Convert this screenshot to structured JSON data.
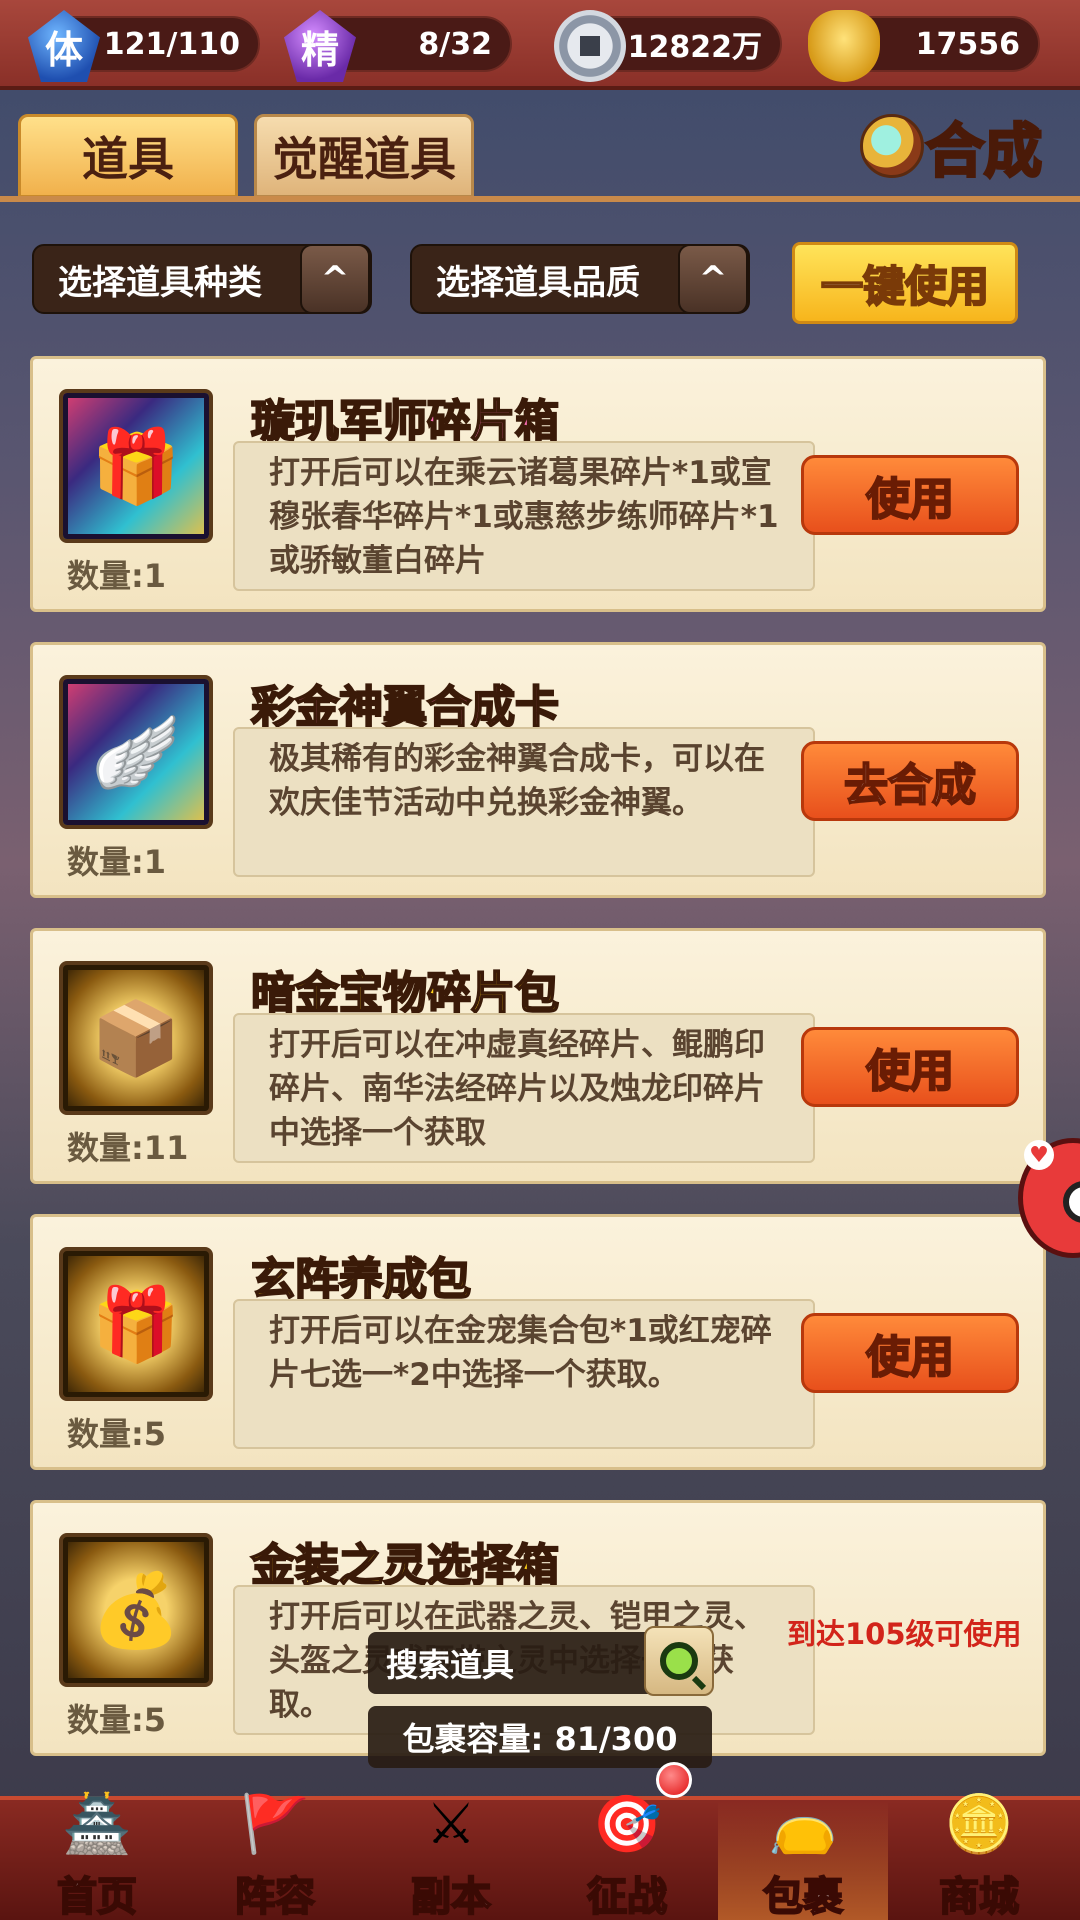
{
  "resources": [
    {
      "icon": "stamina-icon",
      "symbol": "体",
      "value": "121/110"
    },
    {
      "icon": "spirit-icon",
      "symbol": "精",
      "value": "8/32"
    },
    {
      "icon": "coin-icon",
      "symbol": "",
      "value": "12822万"
    },
    {
      "icon": "gold-ingot-icon",
      "symbol": "",
      "value": "17556"
    }
  ],
  "tabs": {
    "items": "道具",
    "awaken_items": "觉醒道具"
  },
  "synth_label": "合成",
  "filters": {
    "type": "选择道具种类",
    "quality": "选择道具品质",
    "arrow": "^",
    "use_all": "一键使用"
  },
  "items": [
    {
      "name": "璇玑军师碎片箱",
      "name_color": "pink",
      "qty": "数量:1",
      "desc": "打开后可以在乘云诸葛果碎片*1或宣穆张春华碎片*1或惠慈步练师碎片*1或骄敏董白碎片",
      "action": "使用",
      "icon": "chest-icon"
    },
    {
      "name": "彩金神翼合成卡",
      "name_color": "pink",
      "qty": "数量:1",
      "desc": "极其稀有的彩金神翼合成卡，可以在欢庆佳节活动中兑换彩金神翼。",
      "action": "去合成",
      "icon": "wing-card-icon"
    },
    {
      "name": "暗金宝物碎片包",
      "name_color": "gold",
      "qty": "数量:11",
      "desc": "打开后可以在冲虚真经碎片、鲲鹏印碎片、南华法经碎片以及烛龙印碎片中选择一个获取",
      "action": "使用",
      "icon": "treasure-chest-icon"
    },
    {
      "name": "玄阵养成包",
      "name_color": "gold",
      "qty": "数量:5",
      "desc": "打开后可以在金宠集合包*1或红宠碎片七选一*2中选择一个获取。",
      "action": "使用",
      "icon": "gift-box-icon"
    },
    {
      "name": "金装之灵选择箱",
      "name_color": "gold",
      "qty": "数量:5",
      "desc": "打开后可以在武器之灵、铠甲之灵、头盔之灵或腰带之灵中选择一个获取。",
      "action": "",
      "note": "到达105级可使用",
      "icon": "gold-chest-icon"
    }
  ],
  "search": {
    "label": "搜索道具",
    "capacity": "包裹容量: 81/300"
  },
  "nav": [
    {
      "label": "首页",
      "icon": "home-icon",
      "glyph": "🏯"
    },
    {
      "label": "阵容",
      "icon": "lineup-icon",
      "glyph": "🚩"
    },
    {
      "label": "副本",
      "icon": "dungeon-icon",
      "glyph": "⚔"
    },
    {
      "label": "征战",
      "icon": "campaign-icon",
      "glyph": "🎯"
    },
    {
      "label": "包裹",
      "icon": "bag-icon",
      "glyph": "👝",
      "active": true
    },
    {
      "label": "商城",
      "icon": "shop-icon",
      "glyph": "🪙"
    }
  ]
}
